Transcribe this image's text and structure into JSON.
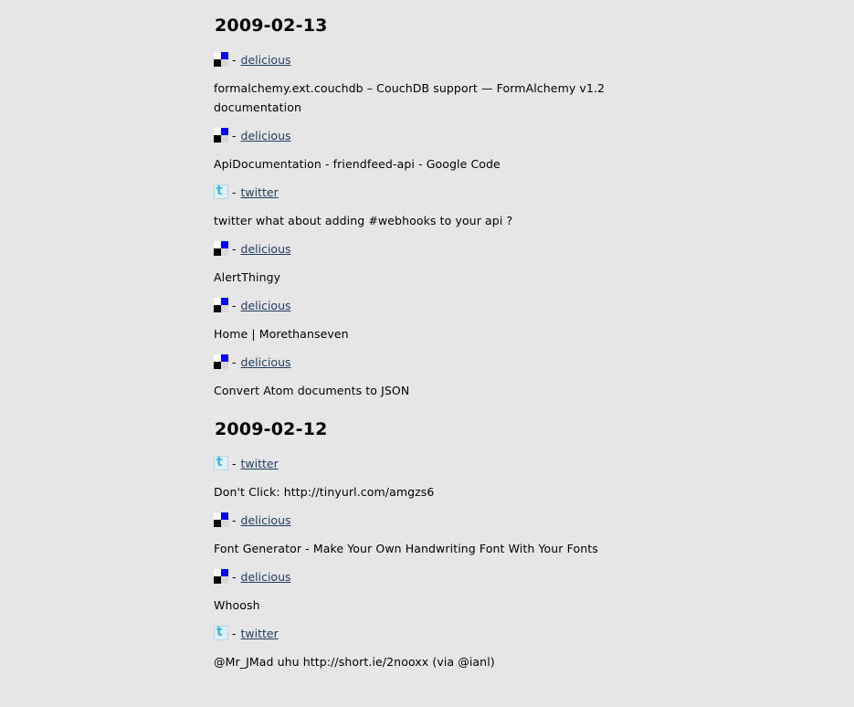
{
  "days": [
    {
      "date": "2009-02-13",
      "entries": [
        {
          "source": "delicious",
          "icon": "delicious-icon",
          "title": "formalchemy.ext.couchdb – CouchDB support — FormAlchemy v1.2 documentation"
        },
        {
          "source": "delicious",
          "icon": "delicious-icon",
          "title": "ApiDocumentation - friendfeed-api - Google Code"
        },
        {
          "source": "twitter",
          "icon": "twitter-icon",
          "title": "twitter what about adding #webhooks to your api ?"
        },
        {
          "source": "delicious",
          "icon": "delicious-icon",
          "title": "AlertThingy"
        },
        {
          "source": "delicious",
          "icon": "delicious-icon",
          "title": "Home | Morethanseven"
        },
        {
          "source": "delicious",
          "icon": "delicious-icon",
          "title": "Convert Atom documents to JSON"
        }
      ]
    },
    {
      "date": "2009-02-12",
      "entries": [
        {
          "source": "twitter",
          "icon": "twitter-icon",
          "title": "Don't Click: http://tinyurl.com/amgzs6"
        },
        {
          "source": "delicious",
          "icon": "delicious-icon",
          "title": "Font Generator - Make Your Own Handwriting Font With Your Fonts"
        },
        {
          "source": "delicious",
          "icon": "delicious-icon",
          "title": "Whoosh"
        },
        {
          "source": "twitter",
          "icon": "twitter-icon",
          "title": "@Mr_JMad uhu http://short.ie/2nooxx (via @ianl)"
        }
      ]
    }
  ],
  "separator": "-",
  "colors": {
    "background": "#e6e6e6",
    "link": "#1f3e62",
    "delicious_blue": "#0000ff",
    "twitter_blue": "#33b8e8"
  }
}
